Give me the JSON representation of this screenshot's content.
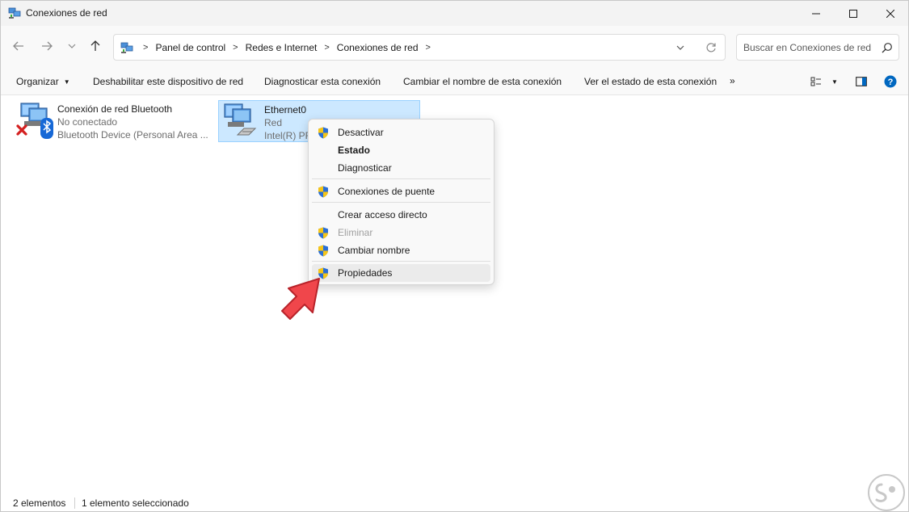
{
  "window": {
    "title": "Conexiones de red"
  },
  "address_bar": {
    "breadcrumbs": [
      "Panel de control",
      "Redes e Internet",
      "Conexiones de red"
    ]
  },
  "search": {
    "placeholder": "Buscar en Conexiones de red"
  },
  "command_bar": {
    "organize": "Organizar",
    "disable_device": "Deshabilitar este dispositivo de red",
    "diagnose": "Diagnosticar esta conexión",
    "rename": "Cambiar el nombre de esta conexión",
    "view_status": "Ver el estado de esta conexión",
    "more": "»"
  },
  "connections": [
    {
      "name": "Conexión de red Bluetooth",
      "status": "No conectado",
      "device": "Bluetooth Device (Personal Area ..."
    },
    {
      "name": "Ethernet0",
      "status": "Red",
      "device": "Intel(R) PRO/1000 MT Network Connection",
      "selected": true
    }
  ],
  "context_menu": {
    "items": [
      {
        "label": "Desactivar",
        "shield": true
      },
      {
        "label": "Estado",
        "bold": true
      },
      {
        "label": "Diagnosticar"
      },
      {
        "label": "Conexiones de puente",
        "shield": true
      },
      {
        "label": "Crear acceso directo"
      },
      {
        "label": "Eliminar",
        "shield": true,
        "disabled": true
      },
      {
        "label": "Cambiar nombre",
        "shield": true
      },
      {
        "label": "Propiedades",
        "shield": true,
        "highlighted": true
      }
    ]
  },
  "status_bar": {
    "count": "2 elementos",
    "selection": "1 elemento seleccionado"
  },
  "colors": {
    "selection_bg": "#cce8ff",
    "selection_border": "#99d1ff",
    "help_blue": "#0067c0",
    "arrow_red": "#f0464b",
    "shield_blue": "#2a6fd6",
    "shield_yellow": "#f5c518"
  },
  "icons": {
    "back": "arrow-left-icon",
    "forward": "arrow-right-icon",
    "recent": "chevron-down-icon",
    "up": "arrow-up-icon",
    "refresh": "refresh-icon",
    "search": "search-icon",
    "help": "help-icon",
    "uac": "uac-shield-icon"
  }
}
